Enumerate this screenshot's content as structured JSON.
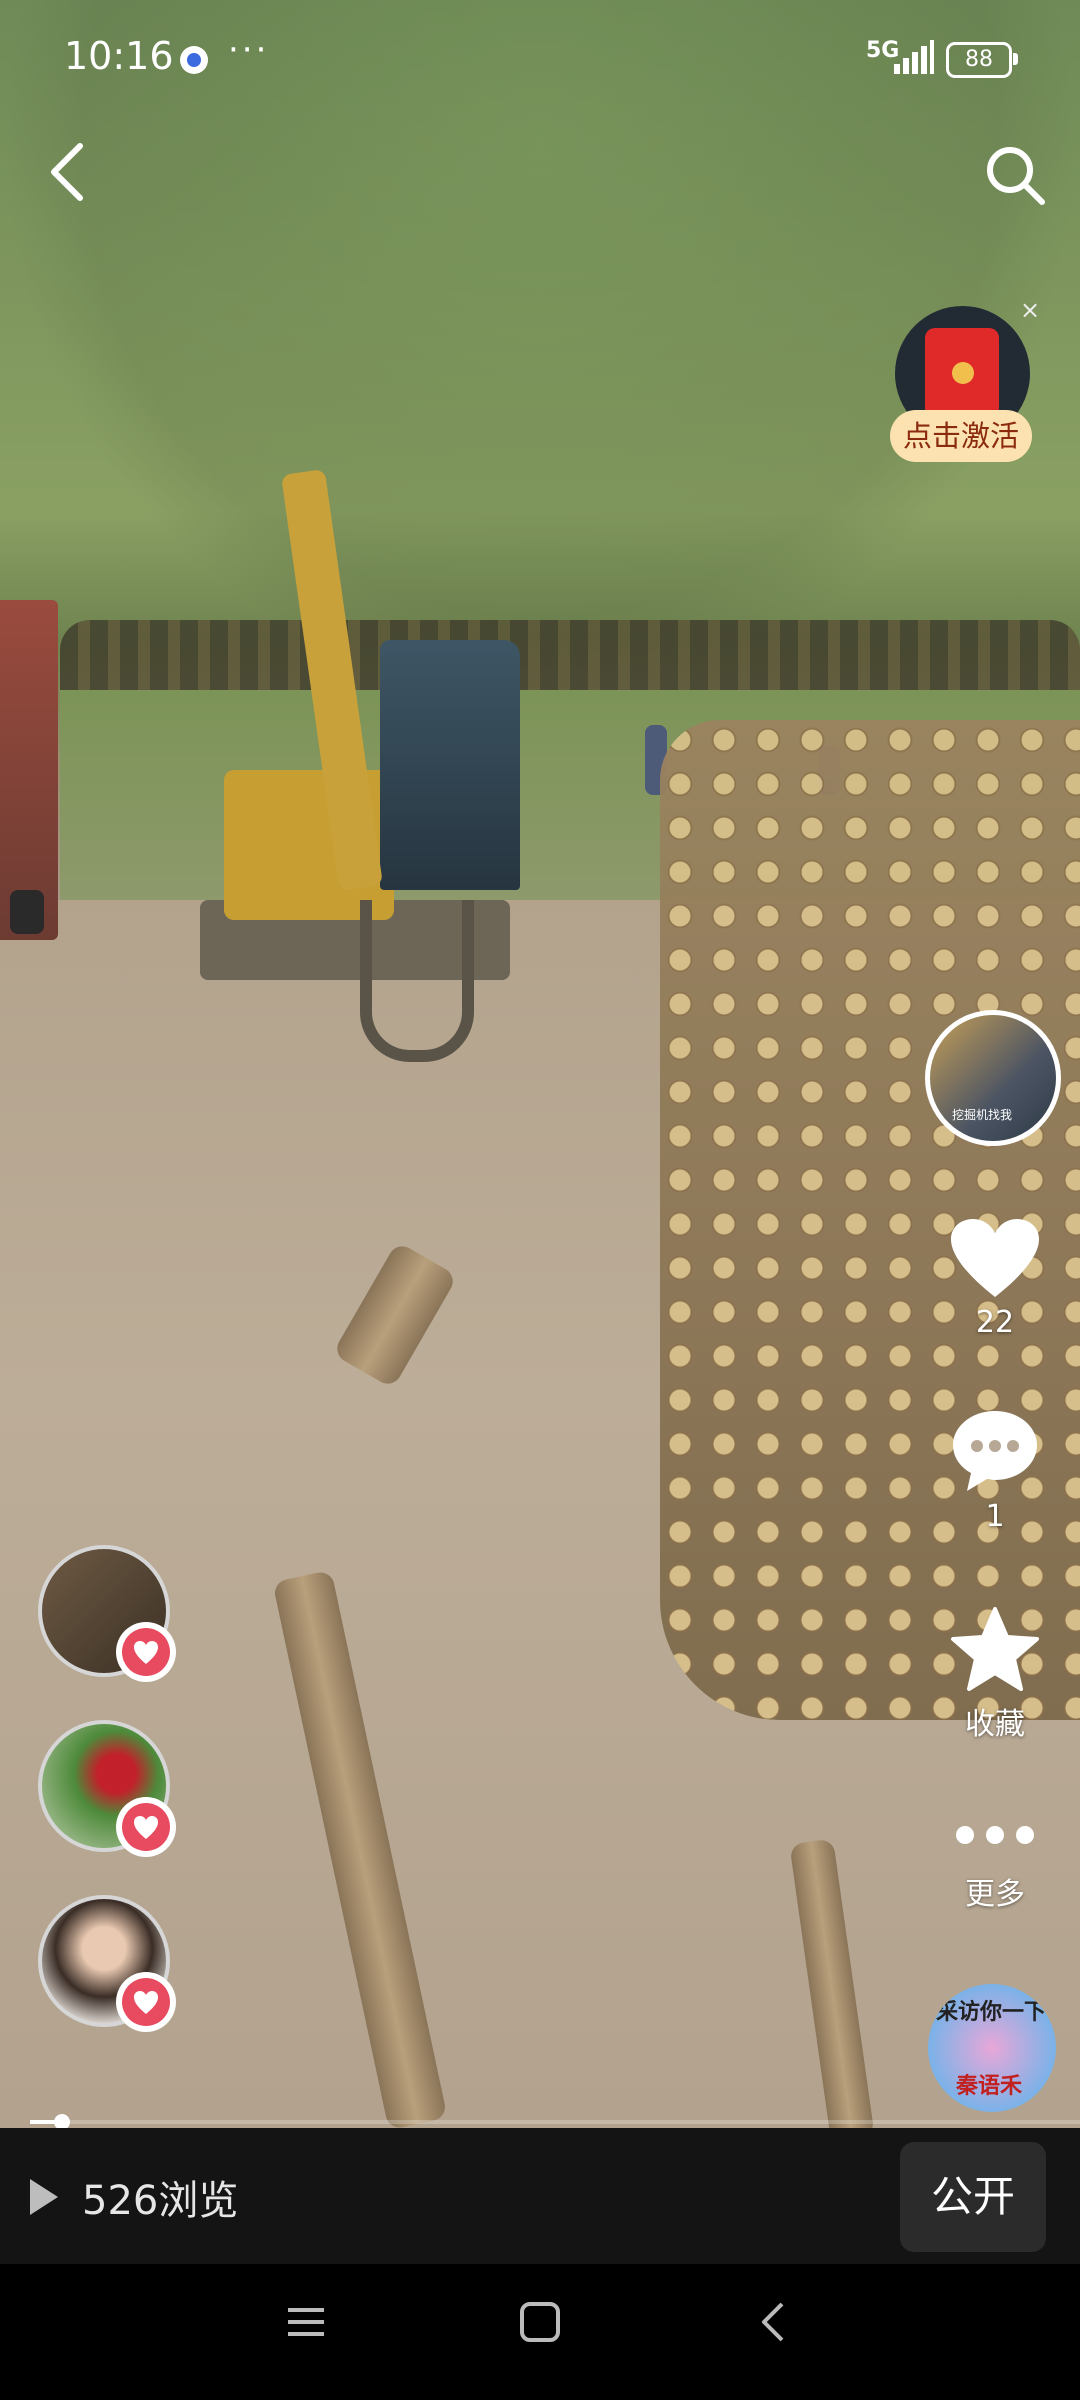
{
  "status_bar": {
    "time": "10:16",
    "more": "···",
    "network": "5G",
    "battery": "88"
  },
  "icons": {
    "back": "chevron-left-icon",
    "search": "search-icon",
    "like": "heart-icon",
    "comment": "comment-icon",
    "favorite": "star-icon",
    "more": "more-dots-icon"
  },
  "promo": {
    "label": "点击激活",
    "close": "×"
  },
  "author": {
    "avatar_caption": "挖掘机找我"
  },
  "actions": {
    "like_count": "22",
    "comment_count": "1",
    "favorite_label": "收藏",
    "more_label": "更多"
  },
  "music_disc": {
    "line1": "采访你一下",
    "line2": "秦语禾"
  },
  "progress": {
    "fraction": 0.03
  },
  "footer": {
    "views": "526浏览",
    "public_button": "公开"
  },
  "colors": {
    "heart_badge": "#e84a5f",
    "footer_bg": "#141414",
    "promo_bg": "#fbe2b0"
  }
}
